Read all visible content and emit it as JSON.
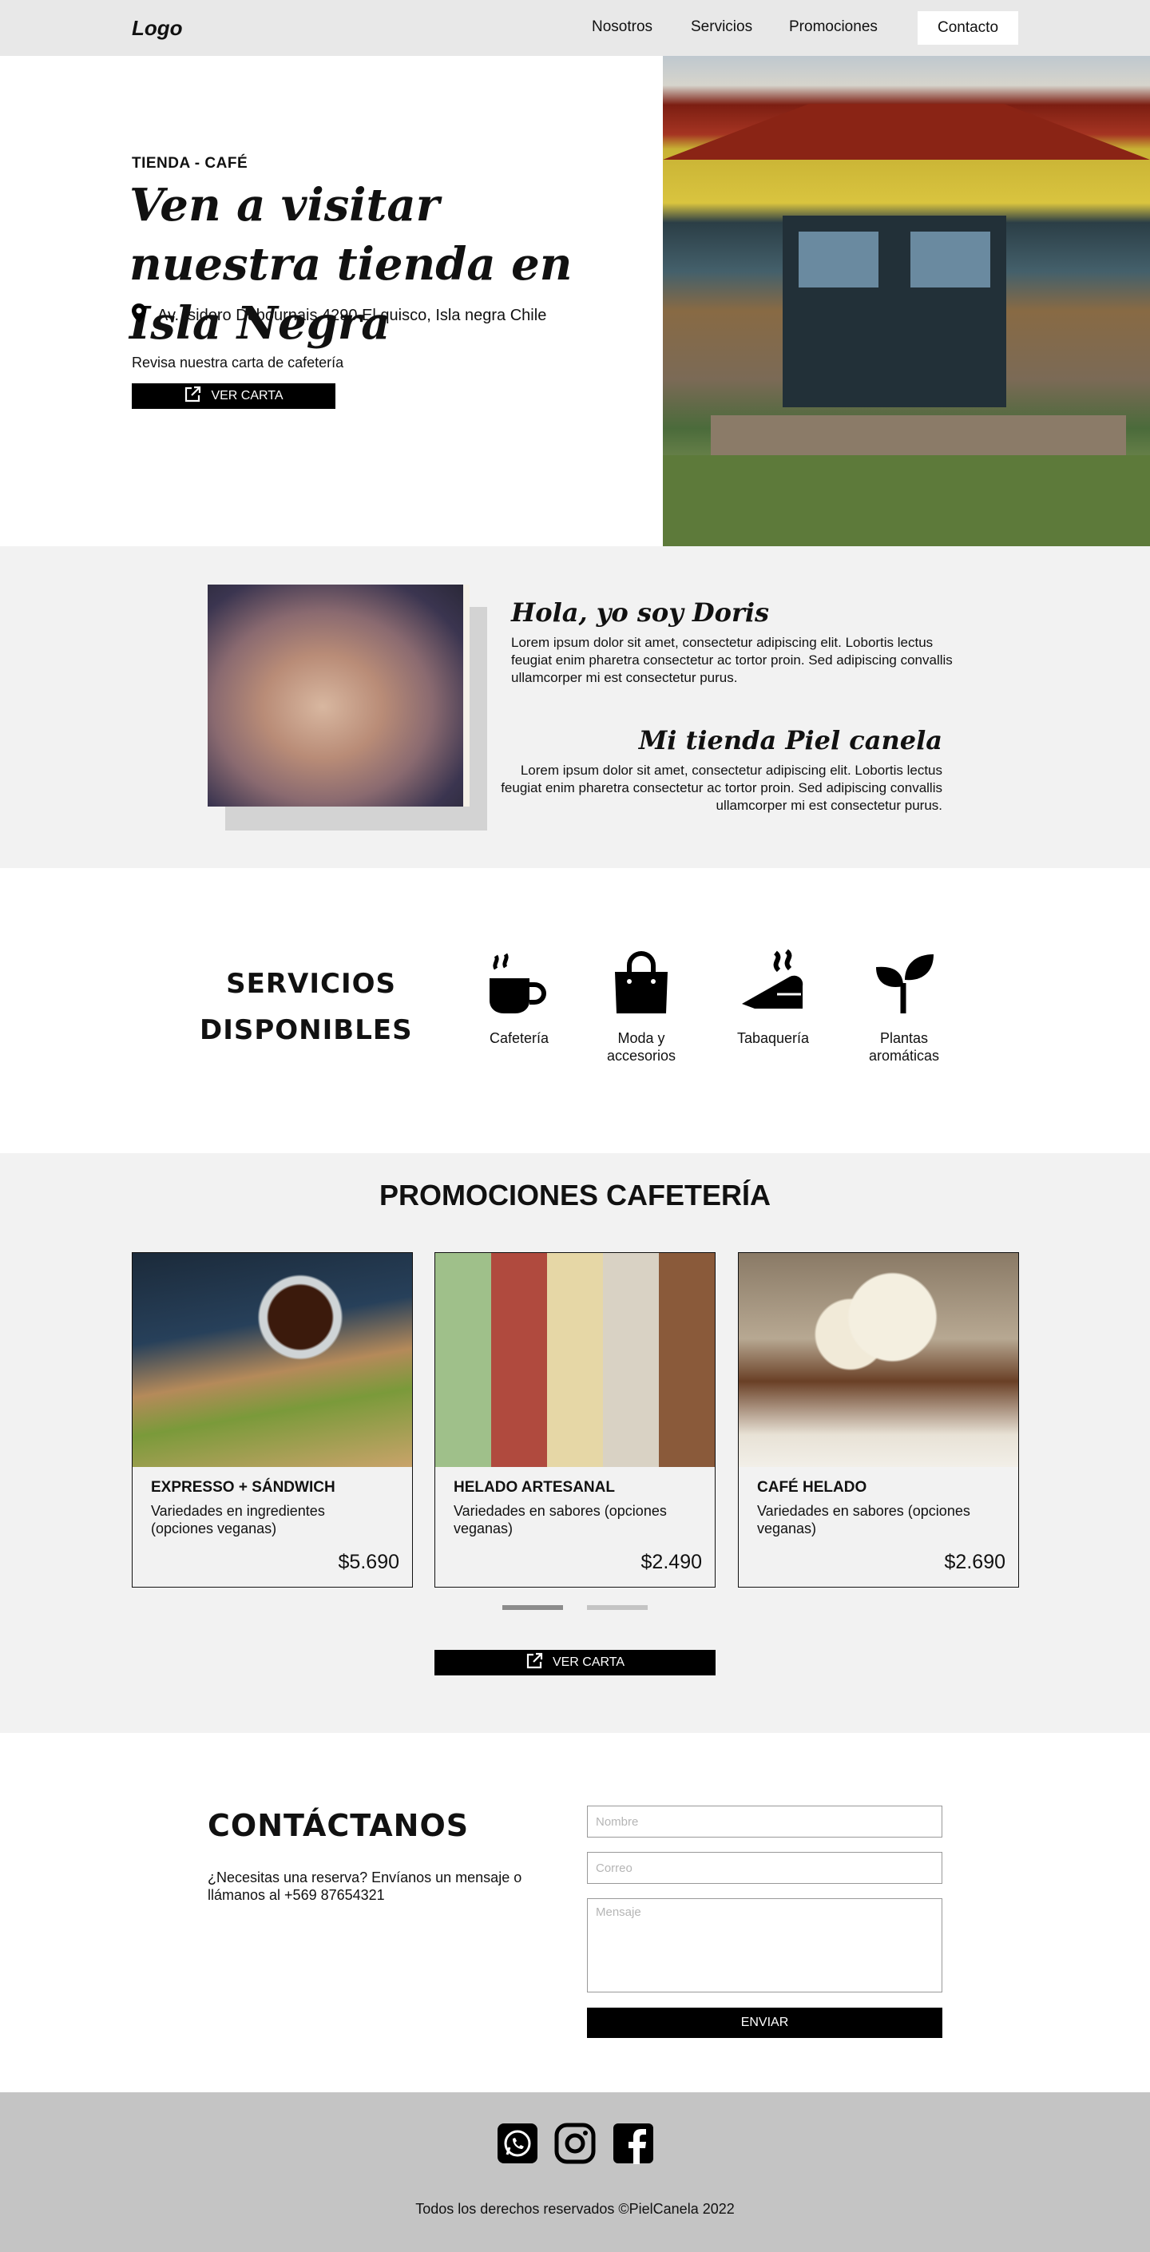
{
  "nav": {
    "logo": "Logo",
    "links": [
      "Nosotros",
      "Servicios",
      "Promociones"
    ],
    "contact": "Contacto"
  },
  "hero": {
    "eyebrow": "TIENDA - CAFÉ",
    "title": "Ven a visitar nuestra tienda en Isla Negra",
    "address": "Av. Isidoro Dubournais 4290 El quisco, Isla negra Chile",
    "note": "Revisa nuestra carta de cafetería",
    "button": "VER CARTA"
  },
  "about": {
    "title1": "Hola, yo soy Doris",
    "text1": "Lorem ipsum dolor sit amet, consectetur adipiscing elit. Lobortis lectus feugiat enim pharetra consectetur ac tortor proin. Sed adipiscing convallis ullamcorper mi est consectetur purus.",
    "title2": "Mi tienda Piel canela",
    "text2": "Lorem ipsum dolor sit amet, consectetur adipiscing elit. Lobortis lectus feugiat enim pharetra consectetur ac tortor proin. Sed adipiscing convallis ullamcorper mi est consectetur purus."
  },
  "services": {
    "title": "SERVICIOS DISPONIBLES",
    "items": [
      {
        "label": "Cafetería",
        "icon": "coffee-cup-icon"
      },
      {
        "label": "Moda y accesorios",
        "icon": "shopping-bag-icon"
      },
      {
        "label": "Tabaquería",
        "icon": "cigar-icon"
      },
      {
        "label": "Plantas aromáticas",
        "icon": "sprout-icon"
      }
    ]
  },
  "promos": {
    "title": "PROMOCIONES CAFETERÍA",
    "cards": [
      {
        "name": "EXPRESSO + SÁNDWICH",
        "desc": "Variedades en ingredientes (opciones veganas)",
        "price": "$5.690"
      },
      {
        "name": "HELADO ARTESANAL",
        "desc": "Variedades en sabores (opciones veganas)",
        "price": "$2.490"
      },
      {
        "name": "CAFÉ HELADO",
        "desc": "Variedades en sabores (opciones veganas)",
        "price": "$2.690"
      }
    ],
    "button": "VER CARTA"
  },
  "contact": {
    "title": "CONTÁCTANOS",
    "text": "¿Necesitas una reserva? Envíanos un mensaje o llámanos al +569 87654321",
    "name_placeholder": "Nombre",
    "email_placeholder": "Correo",
    "message_placeholder": "Mensaje",
    "send": "ENVIAR"
  },
  "footer": {
    "social": [
      "whatsapp-icon",
      "instagram-icon",
      "facebook-icon"
    ],
    "copyright": "Todos los derechos reservados ©PielCanela 2022"
  },
  "colors": {
    "nav_bg": "#e8e8e8",
    "section_gray": "#f2f2f2",
    "footer_bg": "#c4c4c4",
    "button": "#000000"
  }
}
